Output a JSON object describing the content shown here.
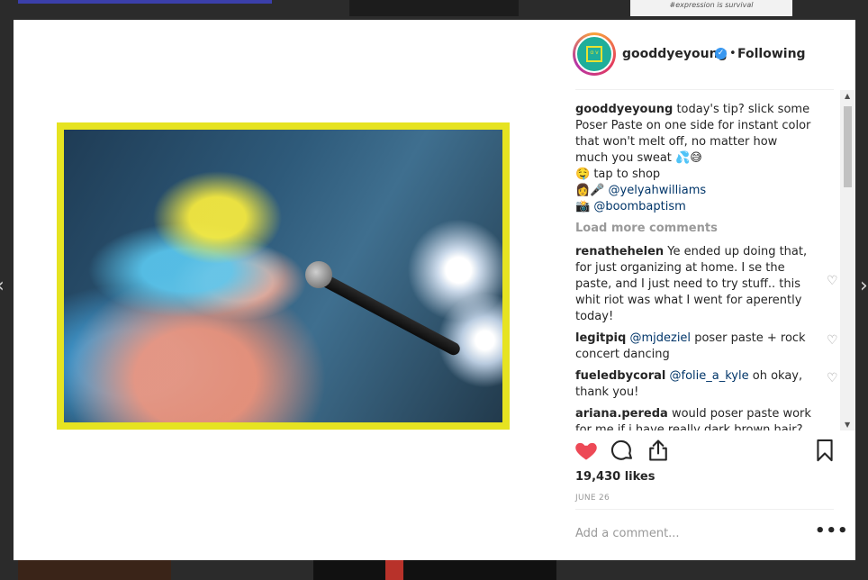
{
  "background": {
    "top_right_caption": "#expression is survival"
  },
  "post": {
    "username": "gooddyeyoung",
    "follow_status": "Following",
    "separator": "•"
  },
  "caption": {
    "username": "gooddyeyoung",
    "text": "today's tip? slick some Poser Paste on one side for instant color that won't melt off, no matter how much you sweat",
    "emoji_1": "💦😅",
    "line2_emoji": "🤤",
    "line2_text": "tap to shop",
    "line3_emoji": "👩🎤",
    "line3_mention": "@yelyahwilliams",
    "line4_emoji": "📸",
    "line4_mention": "@boombaptism"
  },
  "load_more": "Load more comments",
  "comments": [
    {
      "user": "renathehelen",
      "text": "Ye ended up doing that, for just organizing at home. I se the paste, and I just need to try stuff.. this whit riot was what I went for aperently today!"
    },
    {
      "user": "legitpiq",
      "mention": "@mjdeziel",
      "text": "poser paste + rock concert dancing"
    },
    {
      "user": "fueledbycoral",
      "mention": "@folie_a_kyle",
      "text": "oh okay, thank you!"
    },
    {
      "user": "ariana.pereda",
      "text": "would poser paste work for me if i have really dark brown hair?"
    }
  ],
  "likes": "19,430 likes",
  "date": "JUNE 26",
  "add_comment_placeholder": "Add a comment...",
  "more_options": "•••",
  "colors": {
    "accent": "#3897f0",
    "heart": "#ed4956",
    "frame": "#e6e321",
    "avatar_bg": "#1fae9a"
  },
  "icons": {
    "like": "heart-filled-icon",
    "comment": "speech-bubble-icon",
    "share": "share-icon",
    "save": "bookmark-icon",
    "verified": "verified-badge-icon"
  }
}
